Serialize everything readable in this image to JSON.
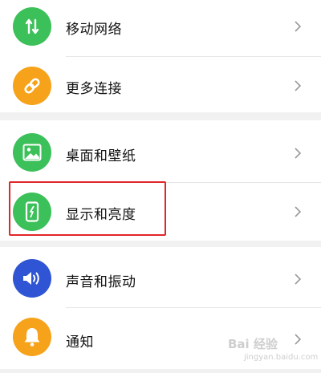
{
  "settings": {
    "items": [
      {
        "label": "移动网络",
        "icon": "mobile-data-icon",
        "color": "#3cc05a"
      },
      {
        "label": "更多连接",
        "icon": "link-icon",
        "color": "#f6a21a"
      },
      {
        "label": "桌面和壁纸",
        "icon": "wallpaper-icon",
        "color": "#3cc05a"
      },
      {
        "label": "显示和亮度",
        "icon": "display-brightness-icon",
        "color": "#3cc05a"
      },
      {
        "label": "声音和振动",
        "icon": "volume-icon",
        "color": "#2f55d4"
      },
      {
        "label": "通知",
        "icon": "bell-icon",
        "color": "#f6a21a"
      }
    ],
    "highlighted_item": "显示和亮度",
    "highlight_color": "#e0262a"
  },
  "watermark": {
    "text": "Bai 经验",
    "sub": "jingyan.baidu.com"
  }
}
